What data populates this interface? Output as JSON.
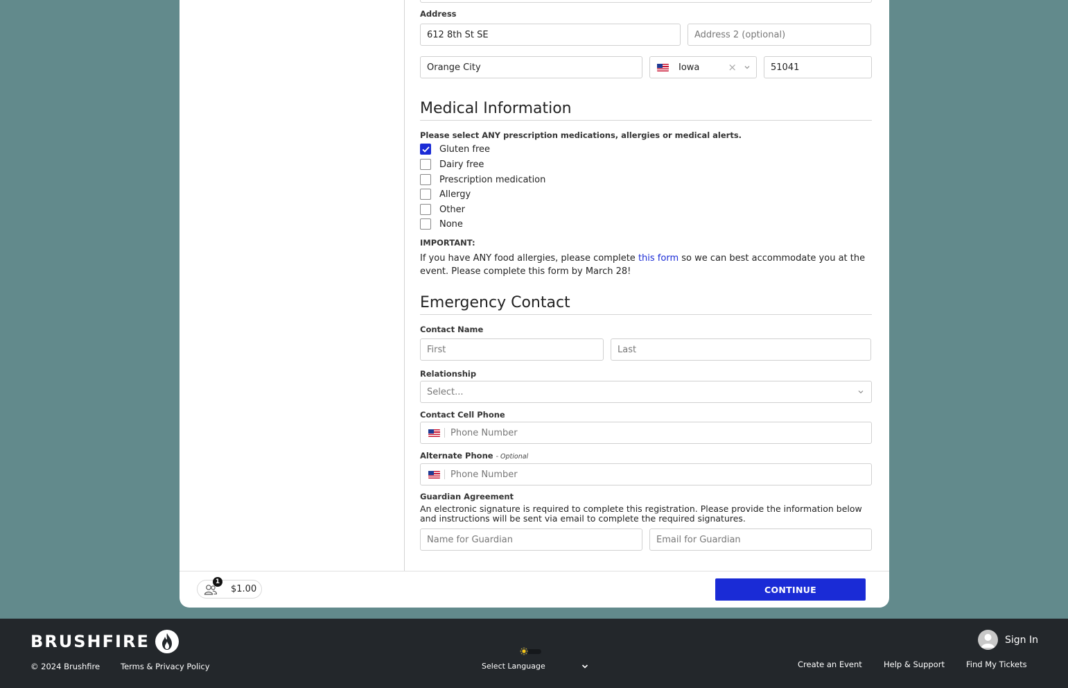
{
  "address": {
    "label": "Address",
    "line1": "612 8th St SE",
    "line2_placeholder": "Address 2 (optional)",
    "city": "Orange City",
    "state": "Iowa",
    "zip": "51041"
  },
  "medical": {
    "title": "Medical Information",
    "prompt": "Please select ANY prescription medications, allergies or medical alerts.",
    "options": [
      {
        "label": "Gluten free",
        "checked": true
      },
      {
        "label": "Dairy free",
        "checked": false
      },
      {
        "label": "Prescription medication",
        "checked": false
      },
      {
        "label": "Allergy",
        "checked": false
      },
      {
        "label": "Other",
        "checked": false
      },
      {
        "label": "None",
        "checked": false
      }
    ],
    "important_label": "IMPORTANT:",
    "important_before": "If you have ANY food allergies, please complete ",
    "important_link": "this form",
    "important_after": " so we can best accommodate you at the event. Please complete this form by March 28!"
  },
  "emergency": {
    "title": "Emergency Contact",
    "contact_name_label": "Contact Name",
    "first_placeholder": "First",
    "last_placeholder": "Last",
    "relationship_label": "Relationship",
    "relationship_placeholder": "Select...",
    "cell_label": "Contact Cell Phone",
    "phone_placeholder": "Phone Number",
    "alt_label": "Alternate Phone",
    "alt_optional": "- Optional",
    "guardian_label": "Guardian Agreement",
    "guardian_text": "An electronic signature is required to complete this registration. Please provide the information below and instructions will be sent via email to complete the required signatures.",
    "guardian_name_placeholder": "Name for Guardian",
    "guardian_email_placeholder": "Email for Guardian"
  },
  "cart": {
    "count": "1",
    "total": "$1.00",
    "continue_label": "CONTINUE"
  },
  "footer": {
    "brand": "BRUSHFIRE",
    "copyright": "© 2024 Brushfire",
    "terms": "Terms & Privacy Policy",
    "language": "Select Language",
    "sign_in": "Sign In",
    "links": [
      "Create an Event",
      "Help & Support",
      "Find My Tickets"
    ]
  },
  "colors": {
    "background": "#628a8c",
    "accent": "#1a2bd6",
    "footer_bg": "#23272b"
  }
}
